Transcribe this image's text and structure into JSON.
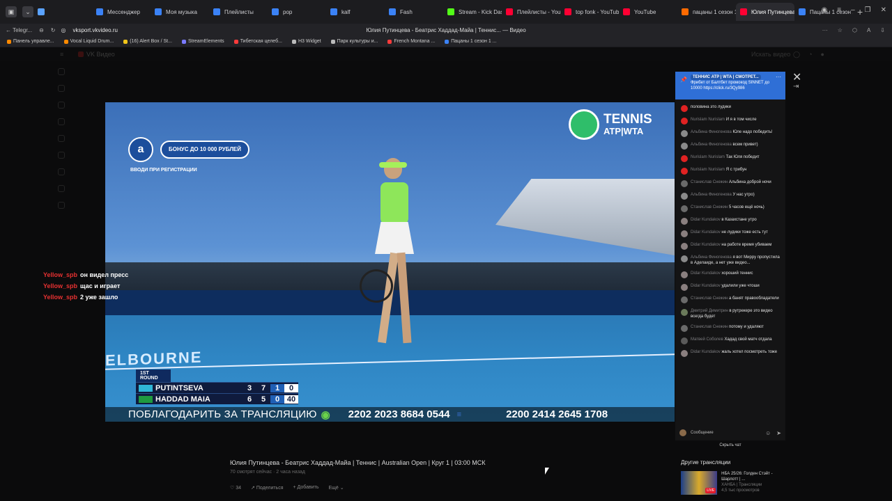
{
  "browser": {
    "tabs": [
      {
        "label": "",
        "color": "#5aa2ff"
      },
      {
        "label": "Мессенджер",
        "color": "#3b82f6"
      },
      {
        "label": "Моя музыка",
        "color": "#3b82f6"
      },
      {
        "label": "Плейлисты",
        "color": "#3b82f6"
      },
      {
        "label": "pop",
        "color": "#3b82f6"
      },
      {
        "label": "kalf",
        "color": "#3b82f6"
      },
      {
        "label": "Fash",
        "color": "#3b82f6"
      },
      {
        "label": "Stream - Kick Dashb",
        "color": "#53fc18"
      },
      {
        "label": "Плейлисты - YouTub",
        "color": "#ff0033"
      },
      {
        "label": "top fonk - YouTube",
        "color": "#ff0033"
      },
      {
        "label": "YouTube",
        "color": "#ff0033"
      },
      {
        "label": "пацаны 1 сезон 1 се",
        "color": "#ff6a00"
      },
      {
        "label": "Юлия Путинцева",
        "color": "#ff0033"
      },
      {
        "label": "Пацаны 1 сезон 1 се",
        "color": "#3b82f6"
      }
    ],
    "address": {
      "back_label": "Telegr...",
      "url": "vksport.vkvideo.ru",
      "page_title": "Юлия Путинцева - Беатрис Хаддад-Майа | Теннис... — Видео"
    },
    "bookmarks": [
      {
        "label": "Панель управле...",
        "color": "#ff8a00"
      },
      {
        "label": "Vocal Liquid Drum...",
        "color": "#ff8a00"
      },
      {
        "label": "(16) Alert Box / St...",
        "color": "#f0c419"
      },
      {
        "label": "StreamElements",
        "color": "#7a7aff"
      },
      {
        "label": "Тибетская целеб...",
        "color": "#ff3b3b"
      },
      {
        "label": "H3 Widget",
        "color": "#bbbbbb"
      },
      {
        "label": "Парк культуры и...",
        "color": "#bbbbbb"
      },
      {
        "label": "French Montana ...",
        "color": "#ff3b3b"
      },
      {
        "label": "Пацаны 1 сезон 1 ...",
        "color": "#3b82f6"
      }
    ]
  },
  "vk": {
    "brand": "VK Видео",
    "search": "Искать видео"
  },
  "video": {
    "promo_badge": "БОНУС ДО 10 000 РУБЛЕЙ",
    "promo_line": "ВВОДИ ПРИ РЕГИСТРАЦИИ",
    "tennis_logo_1": "TENNIS",
    "tennis_logo_2": "ATP|WTA",
    "court_text": "ELBOURNE",
    "score_round": "1ST ROUND",
    "players": [
      {
        "name": "PUTINTSEVA",
        "s1": "3",
        "s2": "7",
        "s3": "1",
        "pts": "0"
      },
      {
        "name": "HADDAD MAIA",
        "s1": "6",
        "s2": "5",
        "s3": "0",
        "pts": "40"
      }
    ],
    "thanks_text": "ПОБЛАГОДАРИТЬ ЗА ТРАНСЛЯЦИЮ",
    "card1": "2202 2023 8684 0544",
    "card2": "2200 2414 2645 1708"
  },
  "side_chat": [
    {
      "user": "Yellow_spb",
      "msg": "он видел пресс"
    },
    {
      "user": "Yellow_spb",
      "msg": "щас и играет"
    },
    {
      "user": "Yellow_spb",
      "msg": "2 уже зашло"
    }
  ],
  "below": {
    "title": "Юлия Путинцева - Беатрис Хаддад-Майа | Теннис | Australian Open | Круг 1 | 03:00 МСК",
    "meta": "70 смотрят сейчас · 2 часа назад",
    "likes": "34",
    "share": "Поделиться",
    "add": "Добавить",
    "more": "Ещё"
  },
  "chat": {
    "pinned_title": "ТЕННИС ATP | WTA | СМОТРЕТ...",
    "pinned_text": "Фрибет от Балтбет промокод SINNET до 10000 https://click.ru/3Qy986",
    "messages": [
      {
        "name": "",
        "text": "половина это лудики",
        "color": "#e02222"
      },
      {
        "name": "Nurislam Nurislam",
        "text": "И я в том числе",
        "color": "#e02222"
      },
      {
        "name": "Альбина Финогенова",
        "text": "Юле надо победить!",
        "color": "#8a8a8a"
      },
      {
        "name": "Альбина Финогенова",
        "text": "всем привет)",
        "color": "#8a8a8a"
      },
      {
        "name": "Nurislam Nurislam",
        "text": "Так Юля победит",
        "color": "#e02222"
      },
      {
        "name": "Nurislam Nurislam",
        "text": "Я с трибун",
        "color": "#e02222"
      },
      {
        "name": "Станислав Снежин",
        "text": "Альбина доброй ночи",
        "color": "#6a6a6a"
      },
      {
        "name": "Альбина Финогенова",
        "text": "У нас утро)",
        "color": "#8a8a8a"
      },
      {
        "name": "Станислав Снежин",
        "text": "5 часов ещё ночь)",
        "color": "#6a6a6a"
      },
      {
        "name": "Didar Kundakov",
        "text": "в Казахстане утро",
        "color": "#8a7f7f"
      },
      {
        "name": "Didar Kundakov",
        "text": "не лудики тоже есть тут",
        "color": "#8a7f7f"
      },
      {
        "name": "Didar Kundakov",
        "text": "на работе время убиваем",
        "color": "#8a7f7f"
      },
      {
        "name": "Альбина Финогенова",
        "text": "я вот Мирру пропустила в Аделаиде, а нет уже видео...",
        "color": "#8a8a8a"
      },
      {
        "name": "Didar Kundakov",
        "text": "хороший теннис",
        "color": "#8a7f7f"
      },
      {
        "name": "Didar Kundakov",
        "text": "удалили уже чтоши",
        "color": "#8a7f7f"
      },
      {
        "name": "Станислав Снежин",
        "text": "а банят правообладатели",
        "color": "#6a6a6a"
      },
      {
        "name": "Дмитрий Димитрин",
        "text": "в рутрекере это видео всегда будет",
        "color": "#6a7a5a"
      },
      {
        "name": "Станислав Снежин",
        "text": "потому и удаляют",
        "color": "#6a6a6a"
      },
      {
        "name": "Матвей Соболев",
        "text": "Хадад свой матч отдала",
        "color": "#5a5a5a"
      },
      {
        "name": "Didar Kundakov",
        "text": "жаль хотел посмотреть тоже",
        "color": "#8a7f7f"
      }
    ],
    "compose_placeholder": "Сообщение",
    "hide_chat": "Скрыть чат"
  },
  "other": {
    "title": "Другие трансляции",
    "card_title": "НБА 25/26: Голден Стэйт - Шарлотт | ...",
    "card_channel": "ХАНБА | Трансляции",
    "card_meta": "4,5 тыс просмотров",
    "live_label": "LIVE"
  }
}
